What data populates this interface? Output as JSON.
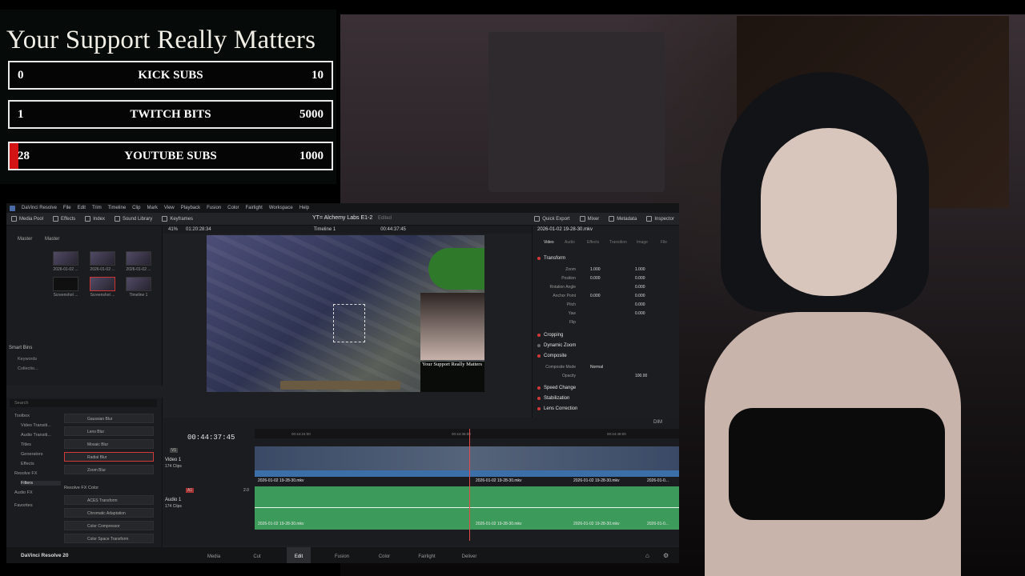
{
  "overlay": {
    "title": "Your Support Really Matters",
    "goals": [
      {
        "current": "0",
        "label": "KICK SUBS",
        "target": "10",
        "progress": 0.0
      },
      {
        "current": "1",
        "label": "TWITCH BITS",
        "target": "5000",
        "progress": 0.0002
      },
      {
        "current": "28",
        "label": "YOUTUBE SUBS",
        "target": "1000",
        "progress": 0.028
      }
    ]
  },
  "resolve": {
    "menu": [
      "DaVinci Resolve",
      "File",
      "Edit",
      "Trim",
      "Timeline",
      "Clip",
      "Mark",
      "View",
      "Playback",
      "Fusion",
      "Color",
      "Fairlight",
      "Workspace",
      "Help"
    ],
    "toolbar_left": [
      "Media Pool",
      "Effects",
      "Index",
      "Sound Library",
      "Keyframes"
    ],
    "project_title": "YT= Alchemy Labs E1-2",
    "project_status": "Edited",
    "toolbar_right": [
      "Quick Export",
      "Mixer",
      "Metadata",
      "Inspector"
    ],
    "media_pool": {
      "tabs": [
        "Master",
        "Master"
      ],
      "clips": [
        {
          "label": "2026-01-02 ..."
        },
        {
          "label": "2026-01-02 ..."
        },
        {
          "label": "2026-01-02 ..."
        },
        {
          "label": "Screenshot ..."
        },
        {
          "label": "Screenshot ..."
        },
        {
          "label": "Timeline 1"
        }
      ],
      "smart_bins_label": "Smart Bins",
      "smart_bins": [
        "Keywords",
        "Collectio..."
      ]
    },
    "viewer": {
      "zoom": "41%",
      "duration": "01:20:28:34",
      "timeline_name": "Timeline 1",
      "timecode": "00:44:37:45",
      "mini_overlay_title": "Your Support Really Matters"
    },
    "inspector": {
      "clip_name": "2026-01-02 19-28-30.mkv",
      "tabs": [
        "Video",
        "Audio",
        "Effects",
        "Transition",
        "Image",
        "File"
      ],
      "sections": [
        "Transform",
        "Cropping",
        "Dynamic Zoom",
        "Composite",
        "Speed Change",
        "Stabilization",
        "Lens Correction"
      ],
      "transform_rows": [
        {
          "name": "Zoom",
          "v1": "1.000",
          "v2": "1.000"
        },
        {
          "name": "Position",
          "v1": "0.000",
          "v2": "0.000"
        },
        {
          "name": "Rotation Angle",
          "v1": "",
          "v2": "0.000"
        },
        {
          "name": "Anchor Point",
          "v1": "0.000",
          "v2": "0.000"
        },
        {
          "name": "Pitch",
          "v1": "",
          "v2": "0.000"
        },
        {
          "name": "Yaw",
          "v1": "",
          "v2": "0.000"
        },
        {
          "name": "Flip",
          "v1": "",
          "v2": ""
        }
      ],
      "composite_mode_label": "Composite Mode",
      "composite_mode": "Normal",
      "opacity_label": "Opacity",
      "opacity": "100.00"
    },
    "effects": {
      "search_placeholder": "Search",
      "categories": [
        "Toolbox",
        "Video Transiti...",
        "Audio Transiti...",
        "Titles",
        "Generators",
        "Effects",
        "Resolve FX",
        "Filters",
        "Audio FX",
        "Favorites"
      ],
      "items": [
        "Gaussian Blur",
        "Lens Blur",
        "Mosaic Blur",
        "Radial Blur",
        "Zoom Blur"
      ],
      "selected_item": "Radial Blur",
      "group_label": "Resolve FX Color",
      "color_items": [
        "ACES Transform",
        "Chromatic Adaptation",
        "Color Compressor",
        "Color Space Transform"
      ]
    },
    "timeline": {
      "timecode": "00:44:37:45",
      "ruler": [
        "00:44:24:00",
        "00:44:36:00",
        "00:44:48:00"
      ],
      "video_track": {
        "name": "Video 1",
        "clips": "174 Clips",
        "id": "V1"
      },
      "audio_track": {
        "name": "Audio 1",
        "clips": "174 Clips",
        "id": "A1",
        "level": "2.0"
      },
      "clip_label": "2026-01-02 19-28-30.mkv",
      "clip_label_short": "2026-01-0...",
      "dim": "DIM"
    },
    "pages": [
      "Media",
      "Cut",
      "Edit",
      "Fusion",
      "Color",
      "Fairlight",
      "Deliver"
    ],
    "active_page": "Edit",
    "brand": "DaVinci Resolve 20"
  }
}
